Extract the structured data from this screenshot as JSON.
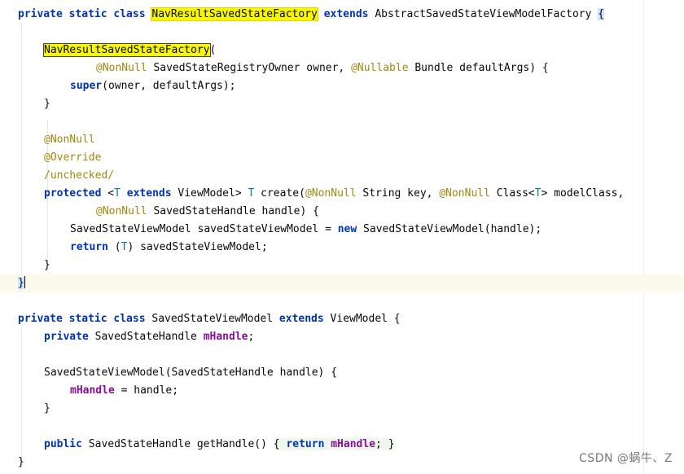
{
  "code": {
    "l1": {
      "kw": "private static class ",
      "cls": "NavResultSavedStateFactory",
      "ext": " extends ",
      "base": "AbstractSavedStateViewModelFactory ",
      "brace": "{"
    },
    "l3": {
      "name": "NavResultSavedStateFactory",
      "paren": "("
    },
    "l4": {
      "ann1": "@NonNull",
      "t1": " SavedStateRegistryOwner owner, ",
      "ann2": "@Nullable",
      "t2": " Bundle defaultArgs) {"
    },
    "l5": {
      "kw": "super",
      "t": "(owner, defaultArgs);"
    },
    "l6": {
      "t": "}"
    },
    "l8": {
      "ann": "@NonNull"
    },
    "l9": {
      "ann": "@Override"
    },
    "l10": {
      "ann": "/unchecked/"
    },
    "l11": {
      "kw": "protected ",
      "lt": "<",
      "g1": "T",
      "ext": " extends ",
      "t1": "ViewModel> ",
      "g2": "T",
      "t2": " create(",
      "ann1": "@NonNull",
      "t3": " String key, ",
      "ann2": "@NonNull",
      "t4": " Class<",
      "g3": "T",
      "t5": "> modelClass,"
    },
    "l12": {
      "ann": "@NonNull",
      "t": " SavedStateHandle handle) {"
    },
    "l13": {
      "t1": "SavedStateViewModel savedStateViewModel = ",
      "kw": "new",
      "t2": " SavedStateViewModel(handle);"
    },
    "l14": {
      "kw": "return",
      "t1": " (",
      "g": "T",
      "t2": ") savedStateViewModel;"
    },
    "l15": {
      "t": "}"
    },
    "l16": {
      "t": "}"
    },
    "l18": {
      "kw": "private static class ",
      "t1": "SavedStateViewModel ",
      "ext": "extends",
      "t2": " ViewModel {"
    },
    "l19": {
      "kw": "private ",
      "t": "SavedStateHandle ",
      "fld": "mHandle",
      "semi": ";"
    },
    "l21": {
      "t": "SavedStateViewModel(SavedStateHandle handle) {"
    },
    "l22": {
      "fld": "mHandle",
      "t": " = handle;"
    },
    "l23": {
      "t": "}"
    },
    "l25": {
      "kw": "public ",
      "t1": "SavedStateHandle getHandle() ",
      "open": "{ ",
      "kw2": "return ",
      "fld": "mHandle",
      "t2": "; ",
      "close": "}"
    },
    "l26": {
      "t": "}"
    }
  },
  "watermark": "CSDN @蜗牛、Z",
  "colors": {
    "keyword": "#0033b3",
    "annotation": "#9e880d",
    "field": "#871094",
    "generic": "#007e8a",
    "highlight": "#f7f700",
    "current_line": "#fcfaed"
  }
}
